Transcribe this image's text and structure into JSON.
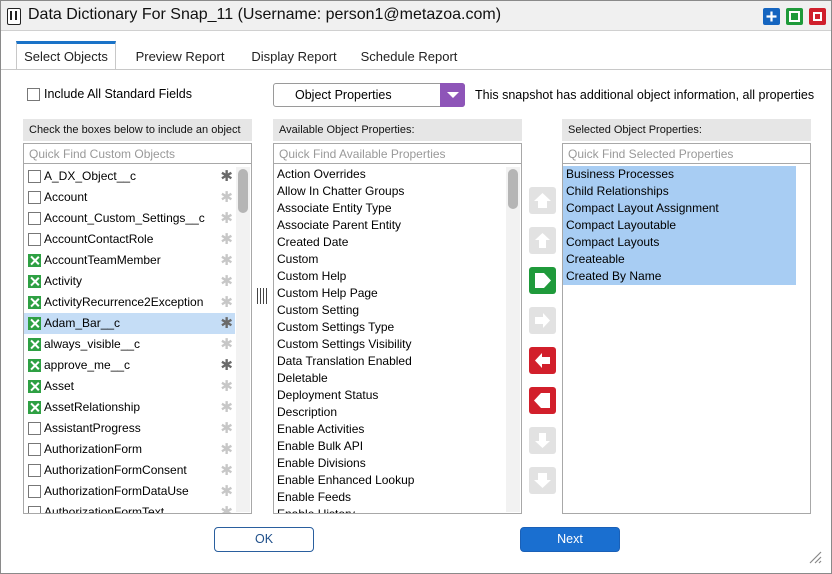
{
  "window": {
    "title": "Data Dictionary For Snap_11 (Username: person1@metazoa.com)",
    "buttons": [
      "maximize-icon",
      "restore-icon",
      "close-icon"
    ]
  },
  "tabs": [
    {
      "label": "Select Objects",
      "active": true
    },
    {
      "label": "Preview Report",
      "active": false
    },
    {
      "label": "Display Report",
      "active": false
    },
    {
      "label": "Schedule Report",
      "active": false
    }
  ],
  "options": {
    "include_standard_label": "Include All Standard Fields",
    "include_standard_checked": false,
    "dropdown_value": "Object Properties",
    "info_text": "This snapshot has additional object information, all properties"
  },
  "objects_panel": {
    "header": "Check the boxes below to include an object",
    "placeholder": "Quick Find Custom Objects",
    "items": [
      {
        "label": "A_DX_Object__c",
        "checked": false,
        "star": "dark"
      },
      {
        "label": "Account",
        "checked": false,
        "star": "light"
      },
      {
        "label": "Account_Custom_Settings__c",
        "checked": false,
        "star": "light"
      },
      {
        "label": "AccountContactRole",
        "checked": false,
        "star": "light"
      },
      {
        "label": "AccountTeamMember",
        "checked": true,
        "star": "light"
      },
      {
        "label": "Activity",
        "checked": true,
        "star": "light"
      },
      {
        "label": "ActivityRecurrence2Exception",
        "checked": true,
        "star": "light"
      },
      {
        "label": "Adam_Bar__c",
        "checked": true,
        "star": "dark",
        "selected": true
      },
      {
        "label": "always_visible__c",
        "checked": true,
        "star": "light"
      },
      {
        "label": "approve_me__c",
        "checked": true,
        "star": "dark"
      },
      {
        "label": "Asset",
        "checked": true,
        "star": "light"
      },
      {
        "label": "AssetRelationship",
        "checked": true,
        "star": "light"
      },
      {
        "label": "AssistantProgress",
        "checked": false,
        "star": "light"
      },
      {
        "label": "AuthorizationForm",
        "checked": false,
        "star": "light"
      },
      {
        "label": "AuthorizationFormConsent",
        "checked": false,
        "star": "light"
      },
      {
        "label": "AuthorizationFormDataUse",
        "checked": false,
        "star": "light"
      },
      {
        "label": "AuthorizationFormText",
        "checked": false,
        "star": "light"
      }
    ]
  },
  "available_panel": {
    "header": "Available Object Properties:",
    "placeholder": "Quick Find Available Properties",
    "items": [
      "Action Overrides",
      "Allow In Chatter Groups",
      "Associate Entity Type",
      "Associate Parent Entity",
      "Created Date",
      "Custom",
      "Custom Help",
      "Custom Help Page",
      "Custom Setting",
      "Custom Settings Type",
      "Custom Settings Visibility",
      "Data Translation Enabled",
      "Deletable",
      "Deployment Status",
      "Description",
      "Enable Activities",
      "Enable Bulk API",
      "Enable Divisions",
      "Enable Enhanced Lookup",
      "Enable Feeds",
      "Enable History"
    ]
  },
  "selected_panel": {
    "header": "Selected Object Properties:",
    "placeholder": "Quick Find Selected Properties",
    "items": [
      "Business Processes",
      "Child Relationships",
      "Compact Layout Assignment",
      "Compact Layoutable",
      "Compact Layouts",
      "Createable",
      "Created By Name"
    ]
  },
  "move_buttons": [
    {
      "name": "move-top-button",
      "icon": "move-top-icon",
      "state": "disabled"
    },
    {
      "name": "move-up-button",
      "icon": "move-up-icon",
      "state": "disabled"
    },
    {
      "name": "add-all-button",
      "icon": "add-all-icon",
      "state": "green"
    },
    {
      "name": "add-selected-button",
      "icon": "add-selected-icon",
      "state": "disabled"
    },
    {
      "name": "remove-selected-button",
      "icon": "remove-selected-icon",
      "state": "red"
    },
    {
      "name": "remove-all-button",
      "icon": "remove-all-icon",
      "state": "red"
    },
    {
      "name": "move-down-button",
      "icon": "move-down-icon",
      "state": "disabled"
    },
    {
      "name": "move-bottom-button",
      "icon": "move-bottom-icon",
      "state": "disabled"
    }
  ],
  "footer": {
    "ok_label": "OK",
    "next_label": "Next"
  },
  "colors": {
    "accent_blue": "#1a6fd0",
    "check_green": "#2ea043",
    "remove_red": "#d21f2b",
    "dropdown_purple": "#8e55b8",
    "selection_blue": "#a8cdf3"
  }
}
